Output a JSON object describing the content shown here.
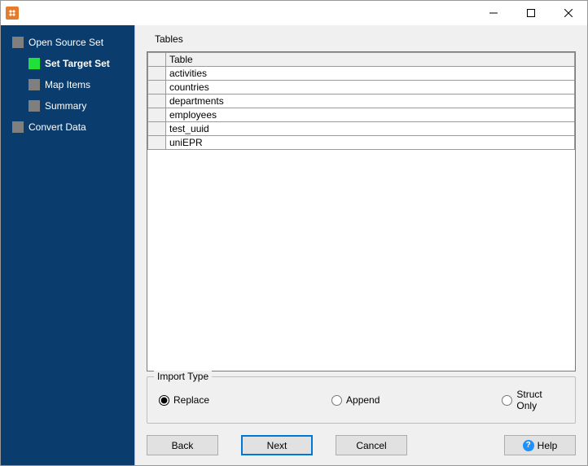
{
  "sidebar": {
    "items": [
      {
        "label": "Open Source Set",
        "level": 0
      },
      {
        "label": "Set Target Set",
        "level": 1,
        "current": true
      },
      {
        "label": "Map Items",
        "level": 1
      },
      {
        "label": "Summary",
        "level": 1
      },
      {
        "label": "Convert Data",
        "level": 0
      }
    ]
  },
  "tables": {
    "section_label": "Tables",
    "header": "Table",
    "rows": [
      "activities",
      "countries",
      "departments",
      "employees",
      "test_uuid",
      "uniEPR"
    ]
  },
  "import_type": {
    "legend": "Import Type",
    "options": [
      {
        "label": "Replace",
        "value": "replace",
        "checked": true
      },
      {
        "label": "Append",
        "value": "append",
        "checked": false
      },
      {
        "label": "Struct Only",
        "value": "struct",
        "checked": false
      }
    ]
  },
  "buttons": {
    "back": "Back",
    "next": "Next",
    "cancel": "Cancel",
    "help": "Help"
  }
}
